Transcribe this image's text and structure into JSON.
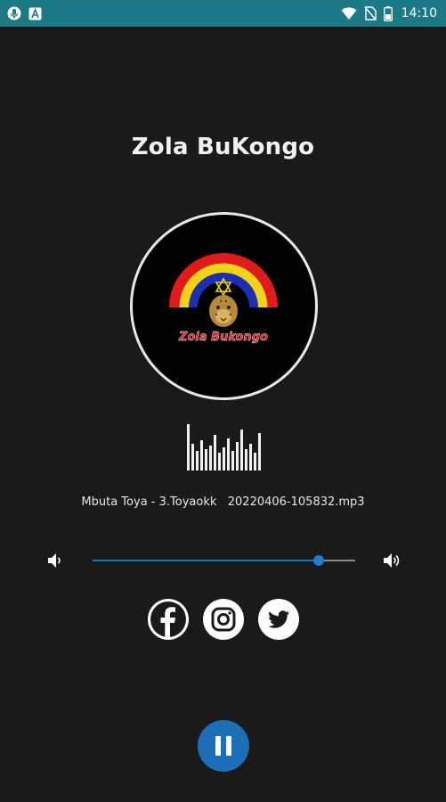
{
  "status_bar": {
    "time": "14:10",
    "left_icons": [
      "microphone-icon",
      "app-a-icon"
    ],
    "right_icons": [
      "wifi-icon",
      "no-sim-icon",
      "battery-icon"
    ],
    "background": "#1b7a86"
  },
  "player": {
    "station_title": "Zola BuKongo",
    "cover_text": "Zola Bukongo",
    "track_name": "Mbuta Toya - 3.Toyaokk   20220406-105832.mp3",
    "volume": 0.86,
    "state": "playing"
  },
  "social": {
    "items": [
      "facebook-icon",
      "instagram-icon",
      "twitter-icon"
    ]
  },
  "colors": {
    "background": "#1a1a1a",
    "accent": "#1c6fb6",
    "text": "#f2f2f2"
  }
}
